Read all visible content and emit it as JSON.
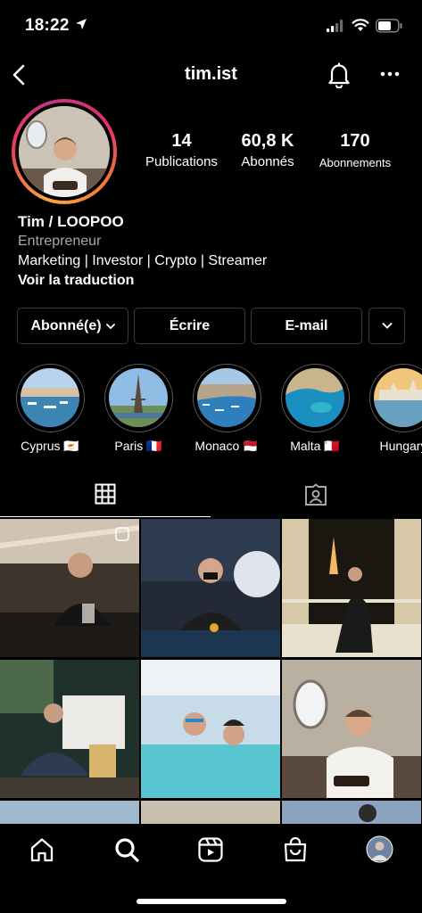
{
  "status_bar": {
    "time": "18:22",
    "icons": [
      "location-arrow-icon",
      "signal-icon",
      "wifi-icon",
      "battery-icon"
    ]
  },
  "nav": {
    "username": "tim.ist",
    "icons": [
      "back-icon",
      "bell-icon",
      "more-icon"
    ]
  },
  "profile": {
    "stats": [
      {
        "value": "14",
        "label": "Publications"
      },
      {
        "value": "60,8 K",
        "label": "Abonnés"
      },
      {
        "value": "170",
        "label": "Abonnements"
      }
    ],
    "name": "Tim / LOOPOO",
    "category": "Entrepreneur",
    "bio": "Marketing | Investor | Crypto | Streamer",
    "translate": "Voir la traduction"
  },
  "actions": {
    "following_label": "Abonné(e)",
    "message_label": "Écrire",
    "email_label": "E-mail"
  },
  "highlights": [
    {
      "label": "Cyprus 🇨🇾"
    },
    {
      "label": "Paris 🇫🇷"
    },
    {
      "label": "Monaco 🇲🇨"
    },
    {
      "label": "Malta 🇲🇹"
    },
    {
      "label": "Hungary"
    }
  ],
  "tabs": [
    "grid-icon",
    "tagged-icon"
  ],
  "bottom_nav": [
    "home-icon",
    "search-icon",
    "reels-icon",
    "shop-icon",
    "profile-avatar"
  ],
  "colors": {
    "background": "#000000",
    "text": "#ffffff",
    "secondary_text": "#a8a8a8",
    "border": "#3a3a3a"
  }
}
